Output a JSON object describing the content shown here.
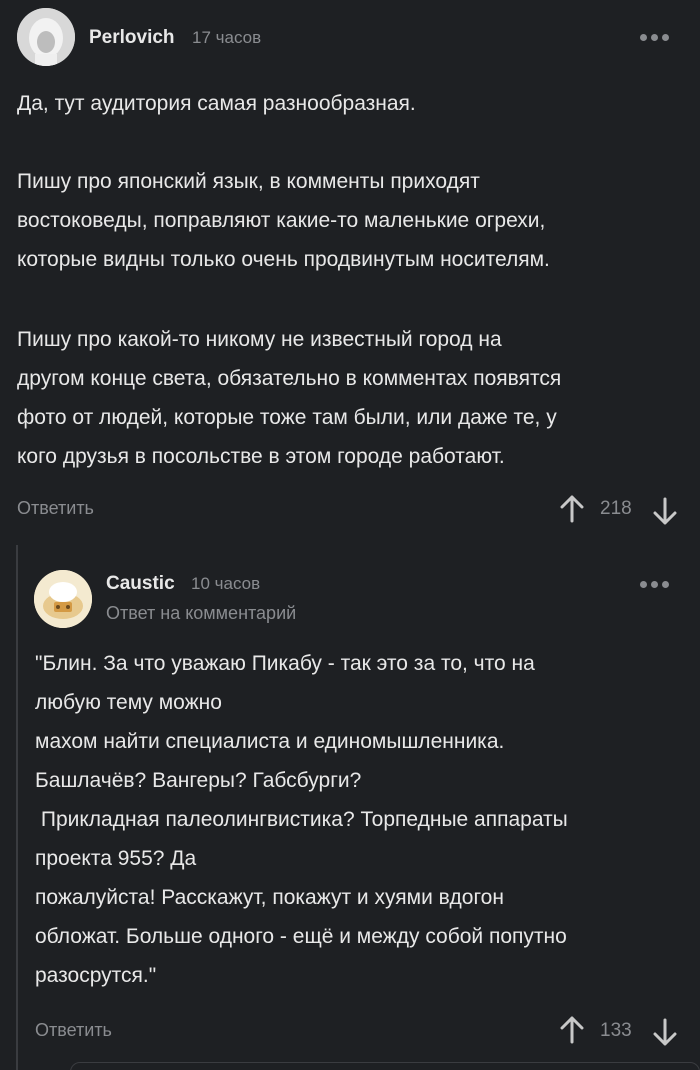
{
  "comment1": {
    "author": "Perlovich",
    "time": "17 часов",
    "paragraphs": [
      "Да, тут аудитория самая разнообразная.",
      "Пишу про японский язык, в комменты приходят\nвостоковеды, поправляют какие-то маленькие огрехи,\nкоторые видны только очень продвинутым носителям.",
      "Пишу про какой-то никому не известный город на\nдругом конце света, обязательно в комментах появятся\nфото от людей, которые тоже там были, или даже те, у\nкого друзья в посольстве в этом городе работают."
    ],
    "reply_label": "Ответить",
    "score": "218",
    "avatar_icon": "user-avatar-hood"
  },
  "comment2": {
    "author": "Caustic",
    "time": "10 часов",
    "subtitle": "Ответ на комментарий",
    "text": "\"Блин. За что уважаю Пикабу - так это за то, что на\nлюбую тему можно\nмахом найти специалиста и единомышленника.\nБашлачёв? Вангеры? Габсбурги?\n Прикладная палеолингвистика? Торпедные аппараты\nпроекта 955? Да\nпожалуйста! Расскажут, покажут и хуями вдогон\nобложат. Больше одного - ещё и между собой попутно\nразосрутся.\"",
    "reply_label": "Ответить",
    "score": "133",
    "avatar_icon": "user-avatar-cartoon"
  },
  "colors": {
    "background": "#1e2023",
    "text": "#e8e8e8",
    "muted": "#8a8c90"
  }
}
